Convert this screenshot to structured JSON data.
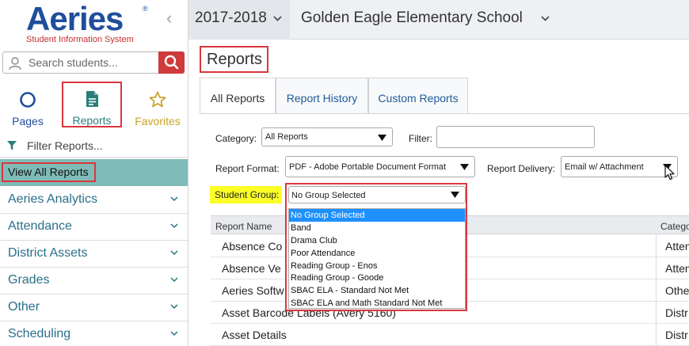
{
  "brand": {
    "name": "Aeries",
    "registered": "®",
    "tagline": "Student Information System"
  },
  "sidebar": {
    "search": {
      "placeholder": "Search students..."
    },
    "nav": [
      {
        "label": "Pages",
        "icon": "circle-icon"
      },
      {
        "label": "Reports",
        "icon": "document-icon"
      },
      {
        "label": "Favorites",
        "icon": "star-icon"
      }
    ],
    "filter_label": "Filter Reports...",
    "view_all": "View All Reports",
    "categories": [
      "Aeries Analytics",
      "Attendance",
      "District Assets",
      "Grades",
      "Other",
      "Scheduling"
    ]
  },
  "header": {
    "school_year": "2017-2018",
    "school": "Golden Eagle Elementary School"
  },
  "main": {
    "title": "Reports",
    "tabs": [
      "All Reports",
      "Report History",
      "Custom Reports"
    ],
    "form": {
      "category_label": "Category:",
      "category_value": "All Reports",
      "filter_label": "Filter:",
      "format_label": "Report Format:",
      "format_value": "PDF - Adobe Portable Document Format",
      "delivery_label": "Report Delivery:",
      "delivery_value": "Email w/ Attachment",
      "group_label": "Student Group:",
      "group_value": "No Group Selected",
      "group_options": [
        "No Group Selected",
        "Band",
        "Drama Club",
        "Poor Attendance",
        "Reading Group - Enos",
        "Reading Group - Goode",
        "SBAC ELA - Standard Not Met",
        "SBAC ELA and Math Standard Not Met"
      ]
    },
    "table": {
      "headers": [
        "Report Name",
        "Catego"
      ],
      "rows": [
        {
          "name": "Absence Co",
          "category": "Atten"
        },
        {
          "name": "Absence Ve",
          "category": "Atten"
        },
        {
          "name": "Aeries Softw",
          "category": "Othe"
        },
        {
          "name": "Asset Barcode Labels (Avery 5160)",
          "category": "Distr"
        },
        {
          "name": "Asset Details",
          "category": "Distr"
        }
      ]
    }
  },
  "colors": {
    "brand_blue": "#1f4e9c",
    "brand_red": "#c62f2f",
    "highlight_red": "#d9363e",
    "teal_selected": "#7fbcb8",
    "highlight_yellow": "#fbff26",
    "option_selected": "#1e90ff"
  }
}
